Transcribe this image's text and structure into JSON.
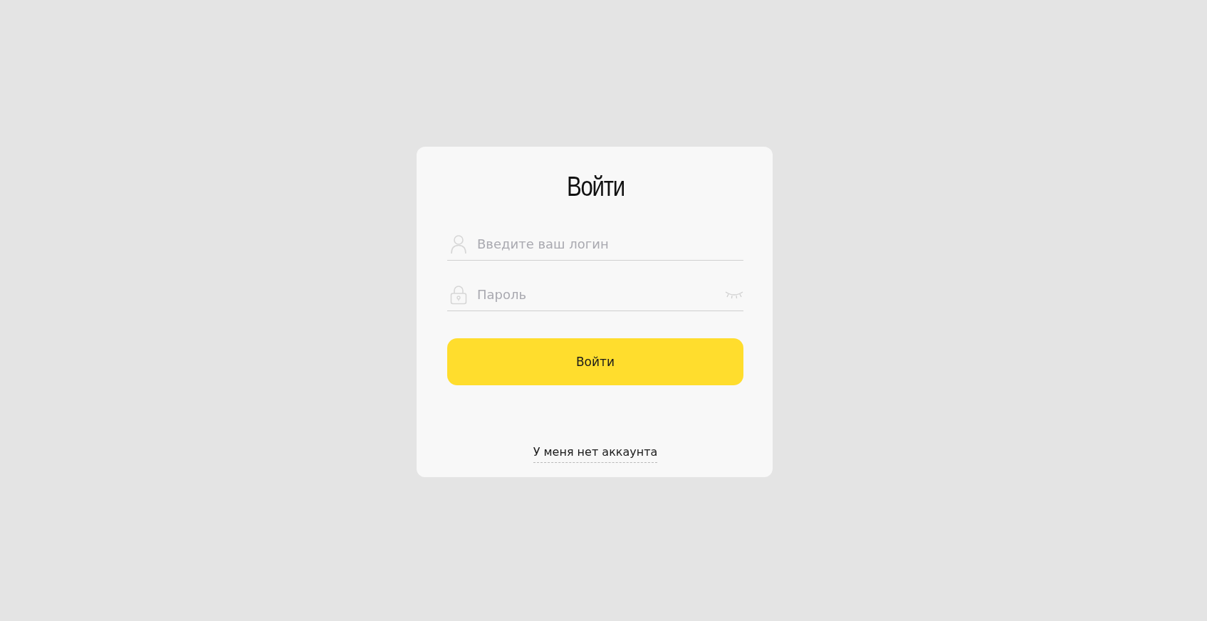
{
  "title": "Войти",
  "fields": [
    {
      "kind": "login",
      "placeholder": "Введите ваш логин"
    },
    {
      "kind": "password",
      "placeholder": "Пароль"
    }
  ],
  "submit_button": "Войти",
  "register_link": "У меня нет аккаунта"
}
